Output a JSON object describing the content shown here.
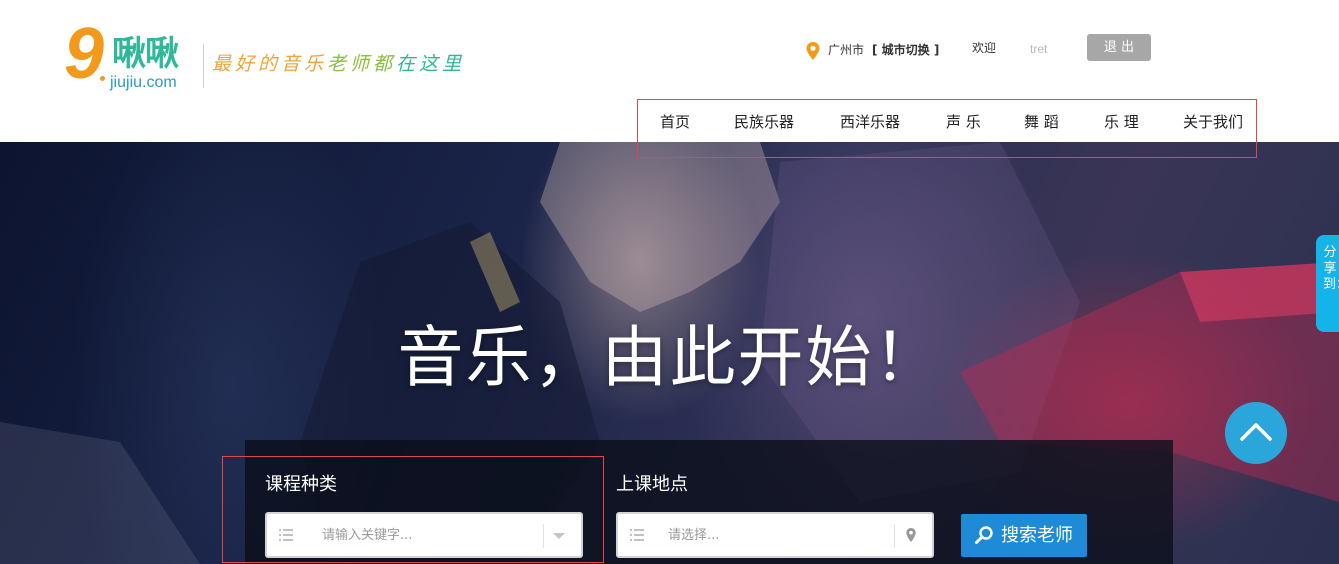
{
  "brand": {
    "logo_digit": "9",
    "logo_name": "啾啾",
    "logo_url": "jiujiu.com",
    "slogan_parts": [
      "最好的音乐",
      "老师都",
      "在这里"
    ]
  },
  "topbar": {
    "city": "广州市",
    "city_switch": "[ 城市切换 ]",
    "welcome": "欢迎",
    "username": "tret",
    "logout": "退 出"
  },
  "nav": {
    "items": [
      "首页",
      "民族乐器",
      "西洋乐器",
      "声 乐",
      "舞 蹈",
      "乐 理",
      "关于我们"
    ]
  },
  "hero": {
    "title": "音乐，由此开始！"
  },
  "search": {
    "course_label": "课程种类",
    "course_placeholder": "请输入关键字...",
    "location_label": "上课地点",
    "location_placeholder": "请选择...",
    "button_label": "搜索老师"
  },
  "share": {
    "label": "分享到：："
  },
  "colors": {
    "brand_orange": "#f39a1d",
    "brand_green": "#2eb89a",
    "search_button": "#1f8ad6",
    "share_tab": "#15b4e8",
    "back_to_top": "#2ba6da",
    "highlight_box": "#e04848"
  },
  "icons": {
    "location": "pin-icon",
    "field_list": "list-icon",
    "dropdown": "caret-down-icon",
    "search": "magnifier-icon",
    "back_to_top": "chevron-up-icon"
  }
}
